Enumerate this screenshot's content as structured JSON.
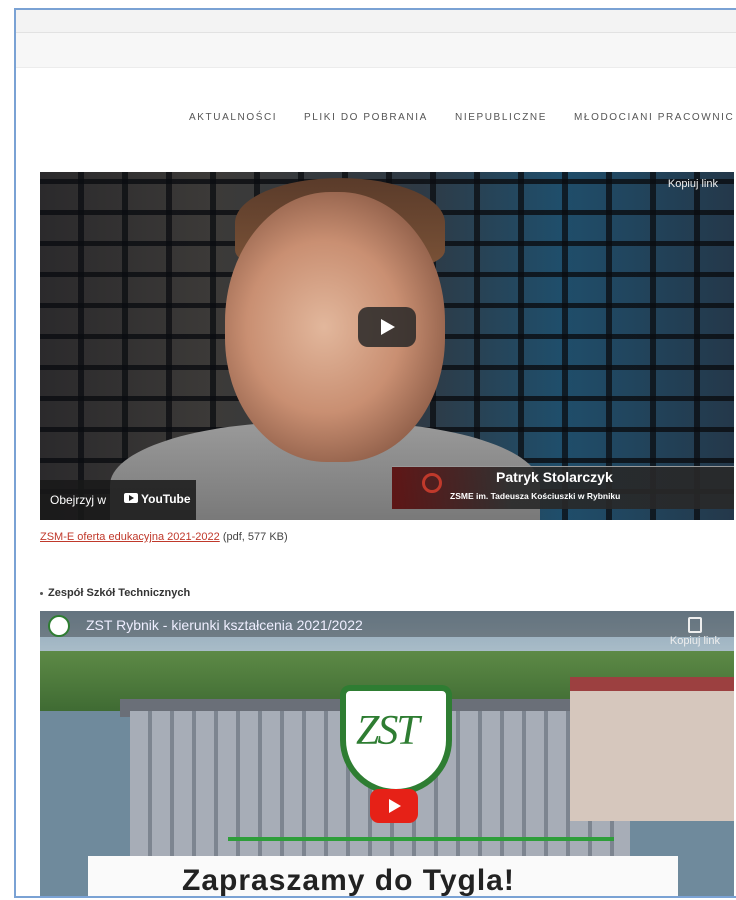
{
  "nav": {
    "items": [
      "AKTUALNOŚCI",
      "PLIKI DO POBRANIA",
      "NIEPUBLICZNE",
      "MŁODOCIANI PRACOWNIC"
    ]
  },
  "video1": {
    "copy_link": "Kopiuj link",
    "watch_label": "Obejrzyj w",
    "youtube_label": "YouTube",
    "name": "Patryk Stolarczyk",
    "school": "ZSME im. Tadeusza Kościuszki w Rybniku"
  },
  "pdf": {
    "link_text": "ZSM-E oferta edukacyjna 2021-2022",
    "meta": " (pdf, 577 KB)"
  },
  "section2": {
    "bullet": "Zespół Szkół Technicznych"
  },
  "video2": {
    "title": "ZST Rybnik - kierunki kształcenia 2021/2022",
    "copy_link": "Kopiuj link",
    "logo_text": "ZST",
    "banner": "Zapraszamy do Tygla!"
  },
  "colors": {
    "link": "#c0392b",
    "accent_green": "#2e7d32",
    "youtube_red": "#e62117"
  }
}
